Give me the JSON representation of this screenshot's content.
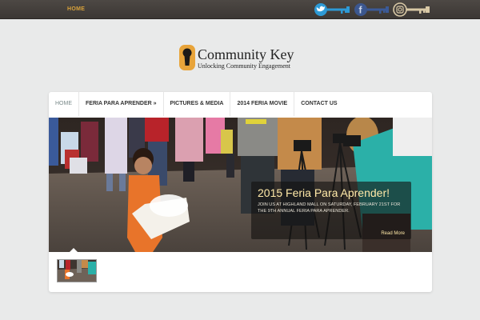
{
  "topbar": {
    "home_label": "HOME",
    "social": [
      {
        "icon": "twitter-key-icon",
        "color": "#2d9ad6"
      },
      {
        "icon": "facebook-key-icon",
        "color": "#3b5a98"
      },
      {
        "icon": "instagram-key-icon",
        "color": "#d9c9a6"
      }
    ]
  },
  "logo": {
    "title": "Community Key",
    "tagline": "Unlocking Community Engagement",
    "icon": "keyhole-logo-icon",
    "accent_color": "#e8a43a"
  },
  "nav": {
    "items": [
      {
        "label": "HOME",
        "active": true
      },
      {
        "label": "FERIA PARA APRENDER »"
      },
      {
        "label": "PICTURES & MEDIA"
      },
      {
        "label": "2014 FERIA MOVIE"
      },
      {
        "label": "CONTACT US"
      }
    ]
  },
  "slide": {
    "title": "2015 Feria Para Aprender!",
    "text": "JOIN US AT HIGHLAND MALL ON SATURDAY, FEBRUARY 21st FOR THE 9th ANNUAL FERIA PARA APRENDER.",
    "more_label": "Read More"
  }
}
